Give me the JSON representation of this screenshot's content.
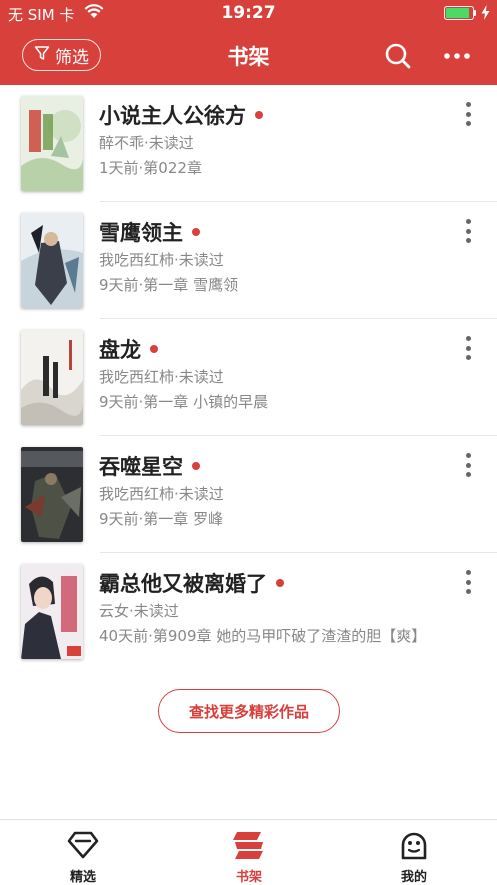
{
  "status_bar": {
    "carrier": "无 SIM 卡",
    "time": "19:27",
    "battery_level": 0.9
  },
  "navbar": {
    "title": "书架",
    "filter_label": "筛选",
    "accent_color": "#d8403c"
  },
  "books": [
    {
      "title": "小说主人公徐方",
      "meta": "醉不乖·未读过",
      "latest": "1天前·第022章"
    },
    {
      "title": "雪鹰领主",
      "meta": "我吃西红柿·未读过",
      "latest": "9天前·第一章 雪鹰领"
    },
    {
      "title": "盘龙",
      "meta": "我吃西红柿·未读过",
      "latest": "9天前·第一章 小镇的早晨"
    },
    {
      "title": "吞噬星空",
      "meta": "我吃西红柿·未读过",
      "latest": "9天前·第一章 罗峰"
    },
    {
      "title": "霸总他又被离婚了",
      "meta": "云女·未读过",
      "latest": "40天前·第909章 她的马甲吓破了渣渣的胆【爽】"
    }
  ],
  "find_more_label": "查找更多精彩作品",
  "tabs": [
    {
      "label": "精选",
      "icon": "diamond-icon"
    },
    {
      "label": "书架",
      "icon": "bookshelf-icon"
    },
    {
      "label": "我的",
      "icon": "face-icon"
    }
  ]
}
